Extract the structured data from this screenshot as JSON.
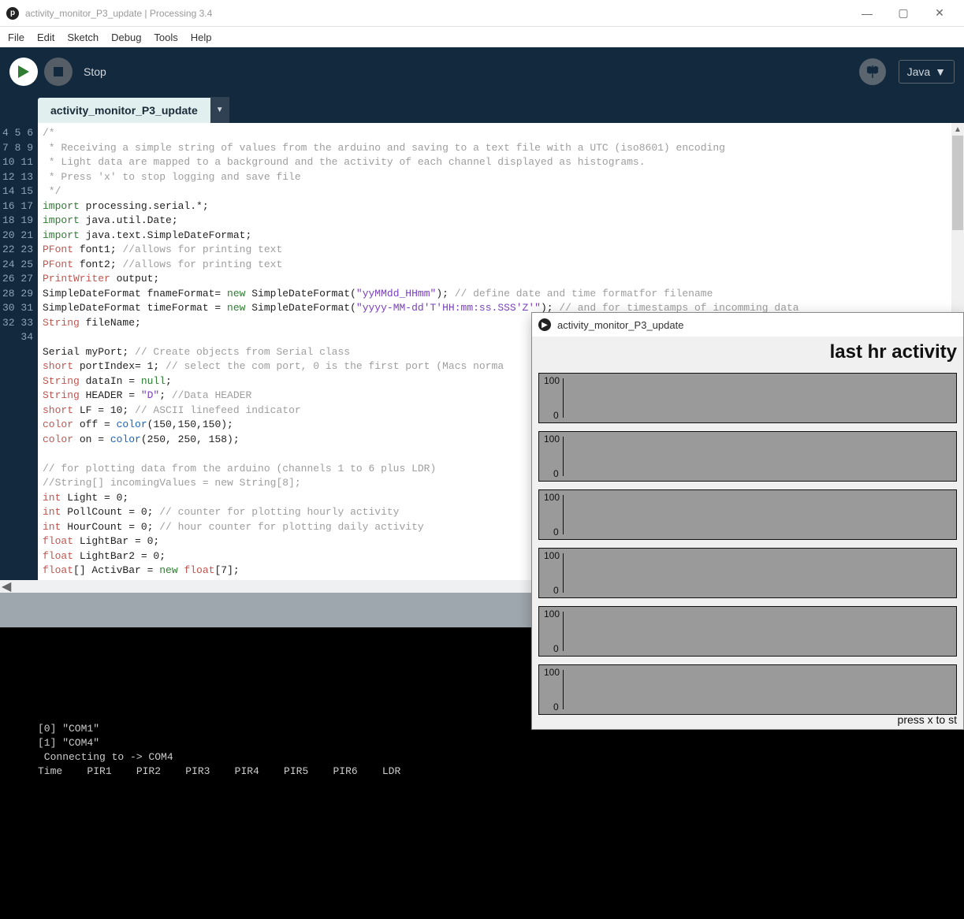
{
  "window": {
    "title": "activity_monitor_P3_update | Processing 3.4",
    "appIconGlyph": "p"
  },
  "menu": {
    "items": [
      "File",
      "Edit",
      "Sketch",
      "Debug",
      "Tools",
      "Help"
    ]
  },
  "toolbar": {
    "stopLabel": "Stop",
    "modeLabel": "Java"
  },
  "tabs": {
    "active": "activity_monitor_P3_update"
  },
  "sketchWindow": {
    "title": "activity_monitor_P3_update",
    "heading": "last hr activity",
    "footer": "press x to st",
    "plot": {
      "yMax": "100",
      "yMin": "0",
      "count": 6
    }
  },
  "chart_data": [
    {
      "type": "bar",
      "title": "",
      "xlabel": "",
      "ylabel": "",
      "ylim": [
        0,
        100
      ],
      "categories": [],
      "values": []
    },
    {
      "type": "bar",
      "title": "",
      "xlabel": "",
      "ylabel": "",
      "ylim": [
        0,
        100
      ],
      "categories": [],
      "values": []
    },
    {
      "type": "bar",
      "title": "",
      "xlabel": "",
      "ylabel": "",
      "ylim": [
        0,
        100
      ],
      "categories": [],
      "values": []
    },
    {
      "type": "bar",
      "title": "",
      "xlabel": "",
      "ylabel": "",
      "ylim": [
        0,
        100
      ],
      "categories": [],
      "values": []
    },
    {
      "type": "bar",
      "title": "",
      "xlabel": "",
      "ylabel": "",
      "ylim": [
        0,
        100
      ],
      "categories": [],
      "values": []
    },
    {
      "type": "bar",
      "title": "",
      "xlabel": "",
      "ylabel": "",
      "ylim": [
        0,
        100
      ],
      "categories": [],
      "values": []
    }
  ],
  "editor": {
    "firstLine": 4,
    "lines": [
      [
        {
          "c": "cmt",
          "t": "/*"
        }
      ],
      [
        {
          "c": "cmt",
          "t": " * Receiving a simple string of values from the arduino and saving to a text file with a UTC (iso8601) encoding"
        }
      ],
      [
        {
          "c": "cmt",
          "t": " * Light data are mapped to a background and the activity of each channel displayed as histograms."
        }
      ],
      [
        {
          "c": "cmt",
          "t": " * Press 'x' to stop logging and save file"
        }
      ],
      [
        {
          "c": "cmt",
          "t": " */"
        }
      ],
      [
        {
          "c": "kw",
          "t": "import"
        },
        {
          "c": "",
          "t": " processing.serial.*;"
        }
      ],
      [
        {
          "c": "kw",
          "t": "import"
        },
        {
          "c": "",
          "t": " java.util.Date;"
        }
      ],
      [
        {
          "c": "kw",
          "t": "import"
        },
        {
          "c": "",
          "t": " java.text.SimpleDateFormat;"
        }
      ],
      [
        {
          "c": "type",
          "t": "PFont"
        },
        {
          "c": "",
          "t": " font1; "
        },
        {
          "c": "cmt",
          "t": "//allows for printing text"
        }
      ],
      [
        {
          "c": "type",
          "t": "PFont"
        },
        {
          "c": "",
          "t": " font2; "
        },
        {
          "c": "cmt",
          "t": "//allows for printing text"
        }
      ],
      [
        {
          "c": "type",
          "t": "PrintWriter"
        },
        {
          "c": "",
          "t": " output;"
        }
      ],
      [
        {
          "c": "",
          "t": "SimpleDateFormat fnameFormat= "
        },
        {
          "c": "kw",
          "t": "new"
        },
        {
          "c": "",
          "t": " SimpleDateFormat("
        },
        {
          "c": "str",
          "t": "\"yyMMdd_HHmm\""
        },
        {
          "c": "",
          "t": "); "
        },
        {
          "c": "cmt",
          "t": "// define date and time formatfor filename"
        }
      ],
      [
        {
          "c": "",
          "t": "SimpleDateFormat timeFormat = "
        },
        {
          "c": "kw",
          "t": "new"
        },
        {
          "c": "",
          "t": " SimpleDateFormat("
        },
        {
          "c": "str",
          "t": "\"yyyy-MM-dd'T'HH:mm:ss.SSS'Z'\""
        },
        {
          "c": "",
          "t": "); "
        },
        {
          "c": "cmt",
          "t": "// and for timestamps of incomming data"
        }
      ],
      [
        {
          "c": "type",
          "t": "String"
        },
        {
          "c": "",
          "t": " fileName;"
        }
      ],
      [
        {
          "c": "",
          "t": ""
        }
      ],
      [
        {
          "c": "",
          "t": "Serial myPort; "
        },
        {
          "c": "cmt",
          "t": "// Create objects from Serial class"
        }
      ],
      [
        {
          "c": "type",
          "t": "short"
        },
        {
          "c": "",
          "t": " portIndex= 1; "
        },
        {
          "c": "cmt",
          "t": "// select the com port, 0 is the first port (Macs norma"
        }
      ],
      [
        {
          "c": "type",
          "t": "String"
        },
        {
          "c": "",
          "t": " dataIn = "
        },
        {
          "c": "kw",
          "t": "null"
        },
        {
          "c": "",
          "t": ";"
        }
      ],
      [
        {
          "c": "type",
          "t": "String"
        },
        {
          "c": "",
          "t": " HEADER = "
        },
        {
          "c": "str",
          "t": "\"D\""
        },
        {
          "c": "",
          "t": "; "
        },
        {
          "c": "cmt",
          "t": "//Data HEADER"
        }
      ],
      [
        {
          "c": "type",
          "t": "short"
        },
        {
          "c": "",
          "t": " LF = 10; "
        },
        {
          "c": "cmt",
          "t": "// ASCII linefeed indicator"
        }
      ],
      [
        {
          "c": "type",
          "t": "color"
        },
        {
          "c": "",
          "t": " off = "
        },
        {
          "c": "fn",
          "t": "color"
        },
        {
          "c": "",
          "t": "(150,150,150);"
        }
      ],
      [
        {
          "c": "type",
          "t": "color"
        },
        {
          "c": "",
          "t": " on = "
        },
        {
          "c": "fn",
          "t": "color"
        },
        {
          "c": "",
          "t": "(250, 250, 158);"
        }
      ],
      [
        {
          "c": "",
          "t": ""
        }
      ],
      [
        {
          "c": "cmt",
          "t": "// for plotting data from the arduino (channels 1 to 6 plus LDR)"
        }
      ],
      [
        {
          "c": "cmt",
          "t": "//String[] incomingValues = new String[8];"
        }
      ],
      [
        {
          "c": "type",
          "t": "int"
        },
        {
          "c": "",
          "t": " Light = 0;"
        }
      ],
      [
        {
          "c": "type",
          "t": "int"
        },
        {
          "c": "",
          "t": " PollCount = 0; "
        },
        {
          "c": "cmt",
          "t": "// counter for plotting hourly activity"
        }
      ],
      [
        {
          "c": "type",
          "t": "int"
        },
        {
          "c": "",
          "t": " HourCount = 0; "
        },
        {
          "c": "cmt",
          "t": "// hour counter for plotting daily activity"
        }
      ],
      [
        {
          "c": "type",
          "t": "float"
        },
        {
          "c": "",
          "t": " LightBar = 0;"
        }
      ],
      [
        {
          "c": "type",
          "t": "float"
        },
        {
          "c": "",
          "t": " LightBar2 = 0;"
        }
      ],
      [
        {
          "c": "type",
          "t": "float"
        },
        {
          "c": "",
          "t": "[] ActivBar = "
        },
        {
          "c": "kw",
          "t": "new"
        },
        {
          "c": "",
          "t": " "
        },
        {
          "c": "type",
          "t": "float"
        },
        {
          "c": "",
          "t": "[7];"
        }
      ]
    ]
  },
  "console": {
    "lines": [
      "[0] \"COM1\"",
      "[1] \"COM4\"",
      " Connecting to -> COM4",
      "Time    PIR1    PIR2    PIR3    PIR4    PIR5    PIR6    LDR"
    ]
  }
}
